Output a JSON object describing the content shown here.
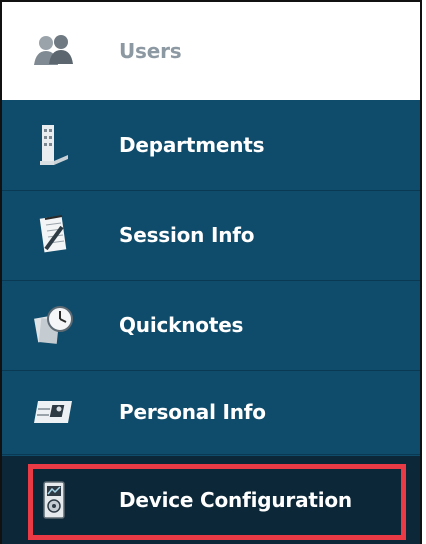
{
  "menu": {
    "items": [
      {
        "label": "Users",
        "icon": "users-icon",
        "active": false
      },
      {
        "label": "Departments",
        "icon": "building-icon",
        "active": false
      },
      {
        "label": "Session Info",
        "icon": "notepad-icon",
        "active": false
      },
      {
        "label": "Quicknotes",
        "icon": "clock-notes-icon",
        "active": false
      },
      {
        "label": "Personal Info",
        "icon": "id-card-icon",
        "active": false
      },
      {
        "label": "Device Configuration",
        "icon": "device-icon",
        "active": true
      }
    ]
  },
  "colors": {
    "sidebar_bg": "#0f4b6a",
    "selected_bg": "#0b2738",
    "highlight_border": "#ea3a46",
    "users_label": "#8d99a2"
  }
}
